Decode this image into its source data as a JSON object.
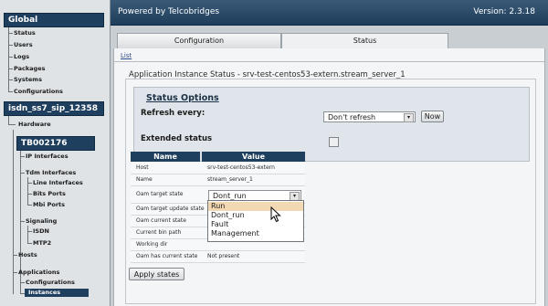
{
  "sidebar": {
    "global_title": "Global",
    "global_items": [
      "Status",
      "Users",
      "Logs",
      "Packages",
      "Systems",
      "Configurations"
    ],
    "device_title": "isdn_ss7_sip_12358",
    "device_items": [
      "Hardware"
    ],
    "board_title": "TB002176",
    "ip_interfaces": "IP Interfaces",
    "tdm_interfaces": "Tdm Interfaces",
    "tdm_sub": [
      "Line Interfaces",
      "Bits Ports",
      "Mbi Ports"
    ],
    "signaling": "Signaling",
    "signaling_sub": [
      "ISDN",
      "MTP2"
    ],
    "hosts": "Hosts",
    "applications": "Applications",
    "applications_sub": [
      "Configurations",
      "Instances"
    ]
  },
  "header": {
    "powered_by": "Powered by Telcobridges",
    "version": "Version: 2.3.18"
  },
  "tabs": [
    {
      "label": "Configuration",
      "active": false
    },
    {
      "label": "Status",
      "active": true
    }
  ],
  "content": {
    "list_link": "List",
    "panel_title": "Application Instance Status - srv-test-centos53-extern.stream_server_1",
    "status_options": {
      "title": "Status Options",
      "refresh_label": "Refresh every:",
      "refresh_value": "Don't refresh",
      "now_button": "Now",
      "extended_label": "Extended status",
      "extended_checked": false
    },
    "table": {
      "headers": [
        "Name",
        "Value"
      ],
      "rows": [
        {
          "name": "Host",
          "value": "srv-test-centos53-extern"
        },
        {
          "name": "Name",
          "value": "stream_server_1"
        },
        {
          "name": "Oam target state",
          "value": "Dont_run"
        },
        {
          "name": "Oam target update state",
          "value": ""
        },
        {
          "name": "Oam current state",
          "value": ""
        },
        {
          "name": "Current bin path",
          "value": ""
        },
        {
          "name": "Working dir",
          "value": ""
        },
        {
          "name": "Oam has current state",
          "value": "Not present"
        }
      ]
    },
    "dropdown_options": [
      "Run",
      "Dont_run",
      "Fault",
      "Management"
    ],
    "dropdown_highlighted": "Run",
    "apply_button": "Apply states"
  },
  "colors": {
    "accent": "#1f3f5e",
    "highlight": "#f3d9b3"
  }
}
